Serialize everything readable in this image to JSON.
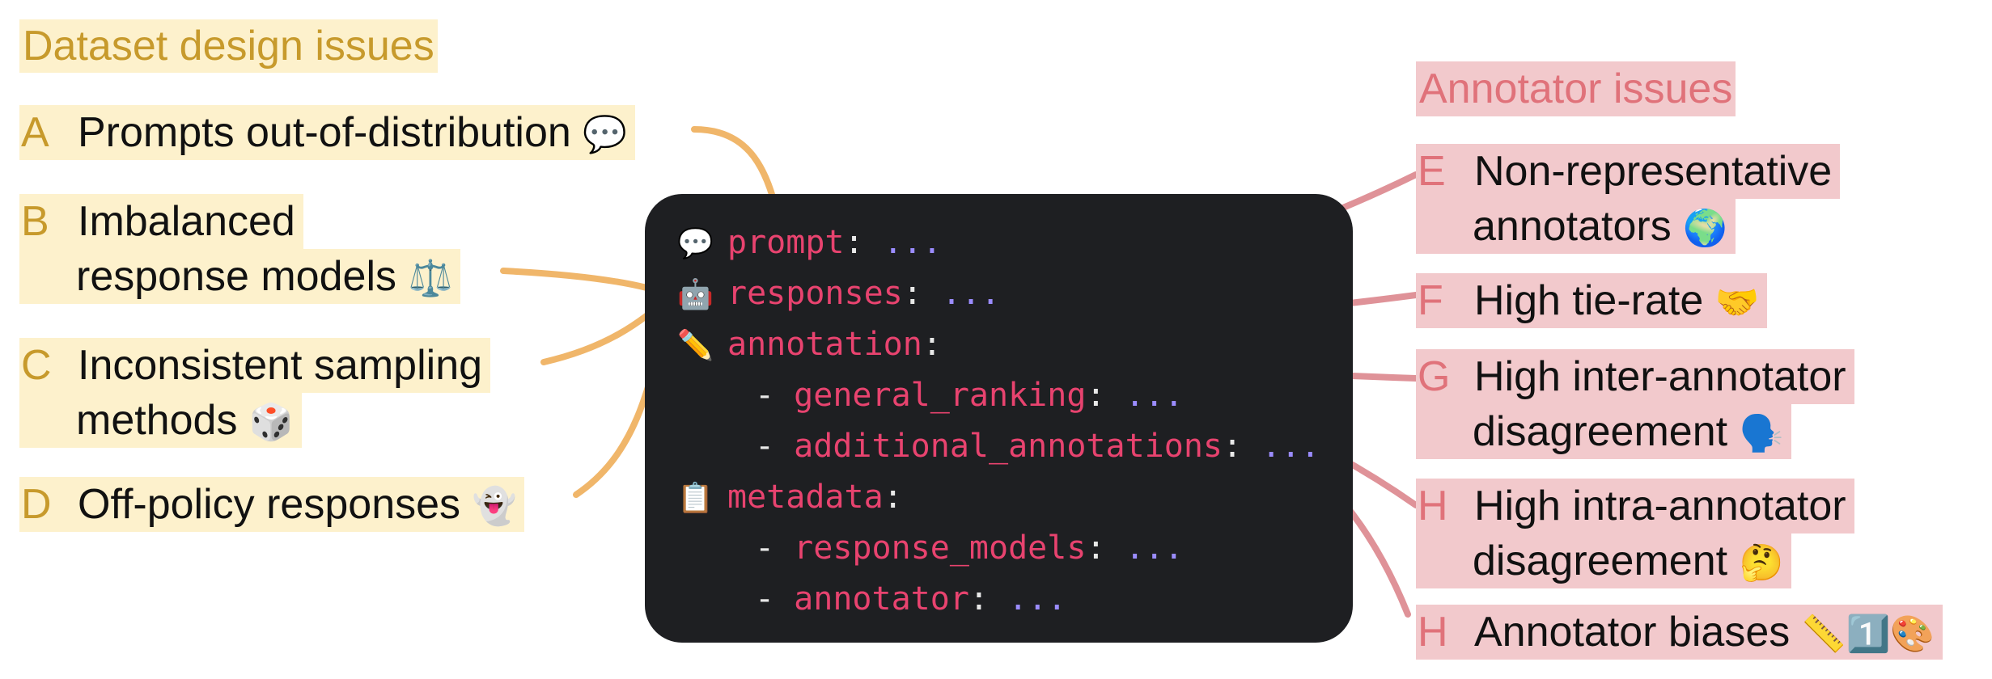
{
  "left_panel": {
    "title": "Dataset design issues",
    "items": [
      {
        "letter": "A",
        "lines": [
          "Prompts out-of-distribution"
        ],
        "emoji": "💬"
      },
      {
        "letter": "B",
        "lines": [
          "Imbalanced",
          "response models"
        ],
        "emoji": "⚖️"
      },
      {
        "letter": "C",
        "lines": [
          "Inconsistent sampling",
          "methods"
        ],
        "emoji": "🎲"
      },
      {
        "letter": "D",
        "lines": [
          "Off-policy responses"
        ],
        "emoji": "👻"
      }
    ]
  },
  "right_panel": {
    "title": "Annotator issues",
    "items": [
      {
        "letter": "E",
        "lines": [
          "Non-representative",
          "annotators"
        ],
        "emoji": "🌍"
      },
      {
        "letter": "F",
        "lines": [
          "High tie-rate"
        ],
        "emoji": "🤝"
      },
      {
        "letter": "G",
        "lines": [
          "High inter-annotator",
          "disagreement"
        ],
        "emoji": "🗣️"
      },
      {
        "letter": "H",
        "lines": [
          "High intra-annotator",
          "disagreement"
        ],
        "emoji": "🤔"
      },
      {
        "letter": "H",
        "lines": [
          "Annotator biases"
        ],
        "emoji": "📏1️⃣🎨"
      }
    ]
  },
  "code": {
    "lines": [
      {
        "icon": "💬",
        "key": "prompt",
        "dots": "..."
      },
      {
        "icon": "🤖",
        "key": "responses",
        "dots": "..."
      },
      {
        "icon": "✏️",
        "key": "annotation",
        "dots": ""
      },
      {
        "dash": "- ",
        "key": "general_ranking",
        "dots": "..."
      },
      {
        "dash": "- ",
        "key": "additional_annotations",
        "dots": "..."
      },
      {
        "icon": "📋",
        "key": "metadata",
        "dots": ""
      },
      {
        "dash": "- ",
        "key": "response_models",
        "dots": "..."
      },
      {
        "dash": "- ",
        "key": "annotator",
        "dots": "..."
      }
    ],
    "colon": ":"
  },
  "colors": {
    "left_accent": "#c79a2c",
    "left_highlight": "#fdf1cc",
    "left_connector": "#f0b66a",
    "right_accent": "#e0727a",
    "right_highlight": "#f2c9cc",
    "right_connector": "#df9298",
    "code_bg": "#1e1f22",
    "code_key": "#e8436f",
    "code_dots": "#9b8cff"
  }
}
